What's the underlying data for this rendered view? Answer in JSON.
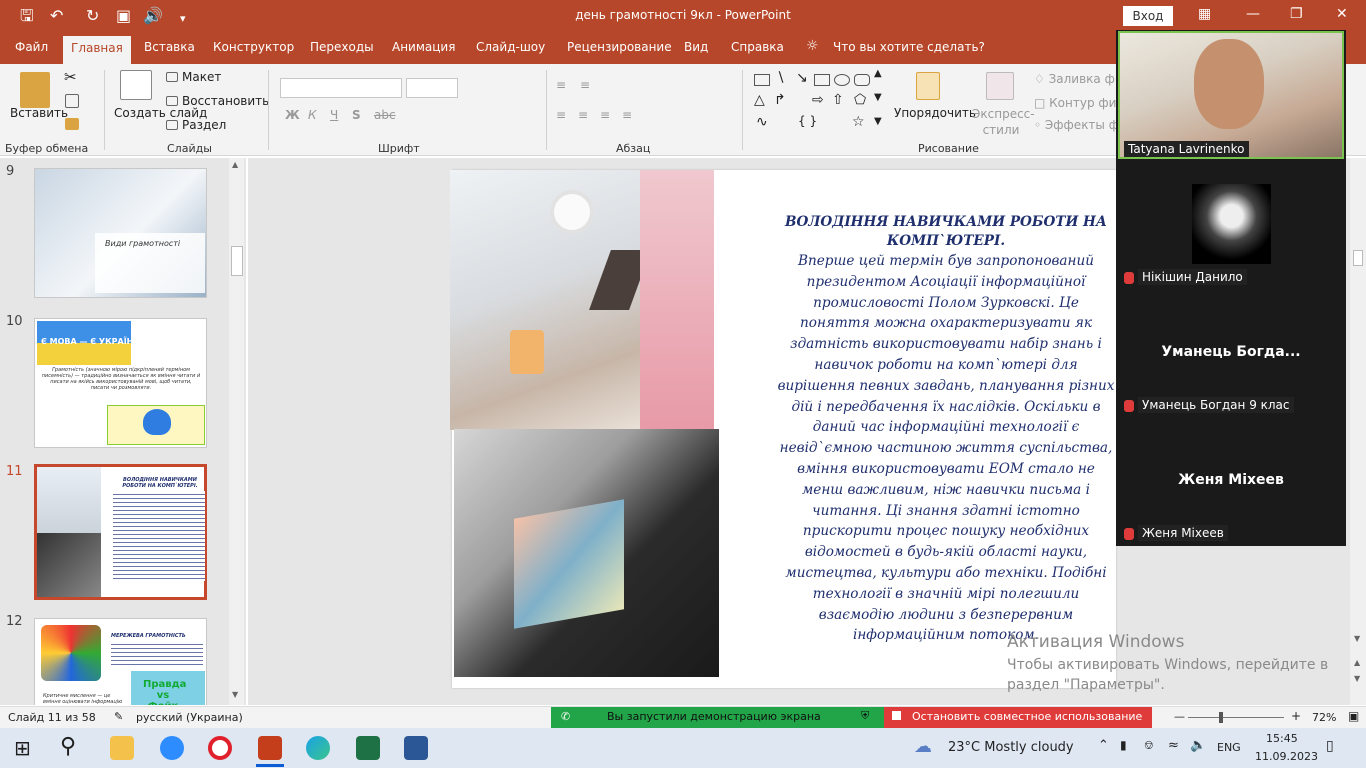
{
  "titlebar": {
    "doc_title": "день грамотності 9кл  -  PowerPoint",
    "login": "Вход",
    "qa_icons": [
      "save-icon",
      "undo-icon",
      "redo-icon",
      "present-icon",
      "audio-icon",
      "customize-icon"
    ]
  },
  "tabs": [
    "Файл",
    "Главная",
    "Вставка",
    "Конструктор",
    "Переходы",
    "Анимация",
    "Слайд-шоу",
    "Рецензирование",
    "Вид",
    "Справка"
  ],
  "tell_me": "Что вы хотите сделать?",
  "ribbon": {
    "paste": "Вставить",
    "create_slide": "Создать слайд",
    "layout": "Макет",
    "reset": "Восстановить",
    "section": "Раздел",
    "arrange": "Упорядочить",
    "quick_styles": "Экспресс-стили",
    "fill": "Заливка фигуры",
    "outline": "Контур фигуры",
    "effects": "Эффекты фигуры",
    "groups": [
      "Буфер обмена",
      "Слайды",
      "Шрифт",
      "Абзац",
      "Рисование"
    ]
  },
  "thumbnails": [
    {
      "num": "9",
      "text": "Види грамотності"
    },
    {
      "num": "10",
      "text": "Є МОВА — Є УКРАЇНА!",
      "caption": "Грамотність (значною мірою підкріплений терміном писемність) — традиційно визначається як вміння читати й писати на якійсь використовуваній мові, щоб читати, писати чи розмовляти."
    },
    {
      "num": "11",
      "text": "ВОЛОДІННЯ НАВИЧКАМИ РОБОТИ НА КОМП`ЮТЕРІ."
    },
    {
      "num": "12",
      "text": "МЕРЕЖЕВА ГРАМОТНІСТЬ",
      "badge": "Правда vs Фейк",
      "caption": "Критичне мислення — це вміння оцінювати інформацію"
    }
  ],
  "slide": {
    "heading": "ВОЛОДІННЯ НАВИЧКАМИ РОБОТИ НА КОМП`ЮТЕРІ.",
    "body": "Вперше цей термін був запропонований президентом Асоціації інформаційної промисловості Полом Зурковскі. Це поняття можна охарактеризувати як здатність використовувати набір знань і навичок роботи на комп`ютері для вирішення певних завдань, планування різних дій і передбачення їх наслідків. Оскільки в даний час інформаційні технології є невід`ємною частиною життя суспільства, вміння використовувати ЕОМ стало не менш важливим, ніж навички письма і читання. Ці знання здатні істотно прискорити процес пошуку необхідних відомостей в будь-якій області науки, мистецтва, культури або техніки. Подібні технології в значній мірі полегшили взаємодію людини з безперервним інформаційним потоком."
  },
  "activation": {
    "title": "Активация Windows",
    "line1": "Чтобы активировать Windows, перейдите в",
    "line2": "раздел \"Параметры\"."
  },
  "meeting": {
    "p1": "Tatyana Lavrinenko",
    "p2": "Нікішин Данило",
    "p3_big": "Уманець  Богда...",
    "p3": "Уманець Богдан 9 клас",
    "p4_big": "Женя Міхеев",
    "p4": "Женя Міхеев"
  },
  "status": {
    "slide": "Слайд 11 из 58",
    "lang": "русский (Украина)",
    "share": "Вы запустили демонстрацию экрана",
    "stop": "Остановить совместное использование",
    "zoom": "72%"
  },
  "taskbar": {
    "weather": "23°C  Mostly cloudy",
    "lang": "ENG",
    "time": "15:45",
    "date": "11.09.2023"
  },
  "colors": {
    "accent": "#b7472a",
    "share_green": "#21a548",
    "stop_red": "#e03b3b",
    "slide_text": "#1f2f6e"
  }
}
